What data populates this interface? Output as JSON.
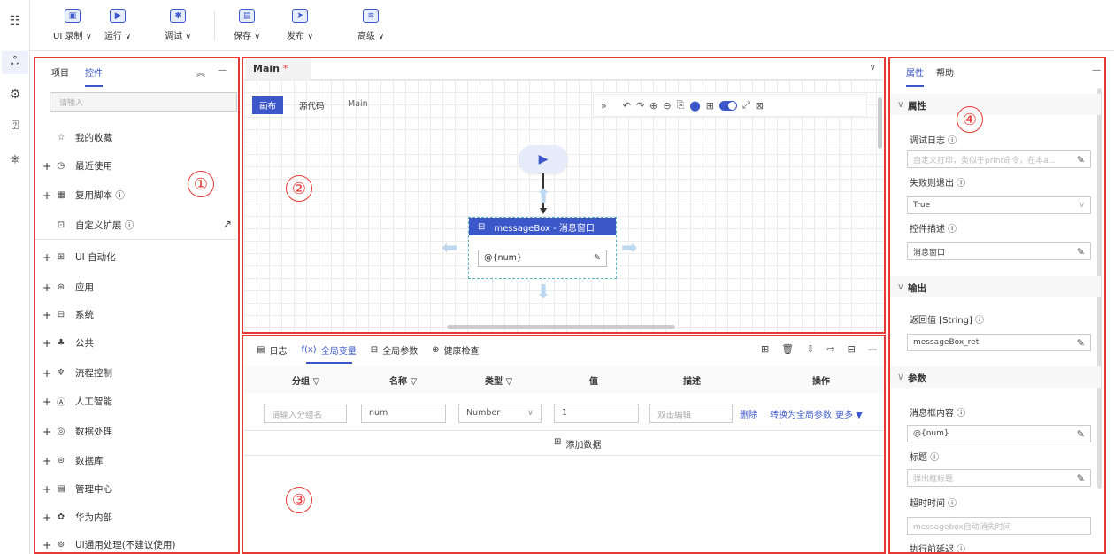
{
  "rail": {
    "icons": [
      "list-icon",
      "nodes-icon",
      "gear-icon",
      "clipboard-icon",
      "puzzle-icon"
    ]
  },
  "toolbar": {
    "items": [
      {
        "label": "UI 录制 ∨",
        "icon": "monitor-icon",
        "glyph": "▣"
      },
      {
        "label": "运行 ∨",
        "icon": "play-icon",
        "glyph": "▶"
      },
      {
        "label": "调试 ∨",
        "icon": "bug-icon",
        "glyph": "✱"
      },
      {
        "label": "保存 ∨",
        "icon": "save-icon",
        "glyph": "▤"
      },
      {
        "label": "发布 ∨",
        "icon": "send-icon",
        "glyph": "➤"
      },
      {
        "label": "高级 ∨",
        "icon": "layers-icon",
        "glyph": "≋"
      }
    ]
  },
  "left": {
    "tabs": [
      "项目",
      "控件"
    ],
    "active_tab": "控件",
    "collapse": "︽",
    "minimize": "—",
    "search_placeholder": "请输入",
    "pinned": [
      {
        "label": "我的收藏",
        "icon": "star-icon",
        "glyph": "☆",
        "plus": ""
      },
      {
        "label": "最近使用",
        "icon": "clock-icon",
        "glyph": "◷",
        "plus": "+"
      },
      {
        "label": "复用脚本 ⓘ",
        "icon": "script-icon",
        "glyph": "▦",
        "plus": "+"
      },
      {
        "label": "自定义扩展 ⓘ",
        "icon": "extension-icon",
        "glyph": "⊡",
        "plus": ""
      }
    ],
    "external_link": "↗",
    "categories": [
      {
        "label": "UI 自动化",
        "icon": "ui-automation-icon",
        "glyph": "⊞"
      },
      {
        "label": "应用",
        "icon": "app-icon",
        "glyph": "⊛"
      },
      {
        "label": "系统",
        "icon": "system-icon",
        "glyph": "⊟"
      },
      {
        "label": "公共",
        "icon": "public-icon",
        "glyph": "♣"
      },
      {
        "label": "流程控制",
        "icon": "flow-icon",
        "glyph": "♆"
      },
      {
        "label": "人工智能",
        "icon": "ai-icon",
        "glyph": "Ⓐ"
      },
      {
        "label": "数据处理",
        "icon": "data-process-icon",
        "glyph": "◎"
      },
      {
        "label": "数据库",
        "icon": "database-icon",
        "glyph": "⊜"
      },
      {
        "label": "管理中心",
        "icon": "manage-icon",
        "glyph": "▤"
      },
      {
        "label": "华为内部",
        "icon": "huawei-icon",
        "glyph": "✿"
      },
      {
        "label": "UI通用处理(不建议使用)",
        "icon": "ui-generic-icon",
        "glyph": "⊚"
      }
    ]
  },
  "editor": {
    "tab": "Main",
    "tab_marker": "*",
    "dropdown": "∨",
    "views": [
      "画布",
      "源代码",
      "Main"
    ],
    "toolbar_glyphs": [
      "»",
      "↶",
      "↷",
      "⊕",
      "⊖",
      "⎘",
      "⬤",
      "⊞",
      "⤢",
      "⊠"
    ],
    "start_glyph": "▶",
    "node_title": "messageBox - 消息窗口",
    "node_value": "@{num}",
    "edit_glyph": "✎"
  },
  "bottom": {
    "tabs": [
      {
        "label": "日志",
        "glyph": "▤"
      },
      {
        "label": "全局变量",
        "glyph": "f(x)"
      },
      {
        "label": "全局参数",
        "glyph": "⊟"
      },
      {
        "label": "健康检查",
        "glyph": "⊕"
      }
    ],
    "active_tab": "全局变量",
    "icon_glyphs": [
      "⊞",
      "🗑",
      "⇩",
      "⇨",
      "⊟",
      "—"
    ],
    "columns": [
      "分组 ▽",
      "名称 ▽",
      "类型 ▽",
      "值",
      "描述",
      "操作"
    ],
    "row": {
      "group_placeholder": "请输入分组名",
      "name": "num",
      "type": "Number",
      "value": "1",
      "desc_placeholder": "双击编辑",
      "actions": [
        "删除",
        "转换为全局参数",
        "更多 ▼"
      ]
    },
    "add_label": "添加数据",
    "add_glyph": "⊞"
  },
  "right": {
    "tabs": [
      "属性",
      "帮助"
    ],
    "active_tab": "属性",
    "minimize": "—",
    "sections": {
      "props": "属性",
      "output": "输出",
      "params": "参数"
    },
    "fields": {
      "debug_log": {
        "label": "调试日志 ⓘ",
        "placeholder": "自定义打印，类似于print命令，在本a..."
      },
      "fail_exit": {
        "label": "失败则退出 ⓘ",
        "value": "True"
      },
      "desc": {
        "label": "控件描述 ⓘ",
        "value": "消息窗口"
      },
      "ret": {
        "label": "返回值 [String] ⓘ",
        "value": "messageBox_ret"
      },
      "msg": {
        "label": "消息框内容 ⓘ",
        "value": "@{num}"
      },
      "title": {
        "label": "标题 ⓘ",
        "placeholder": "弹出框标题"
      },
      "timeout": {
        "label": "超时时间 ⓘ",
        "placeholder": "messagebox自动消失时间"
      },
      "delay": {
        "label": "执行前延迟 ⓘ"
      }
    }
  },
  "annotations": [
    "①",
    "②",
    "③",
    "④"
  ],
  "colors": {
    "accent": "#3b57c9",
    "annotation": "#e53935"
  }
}
